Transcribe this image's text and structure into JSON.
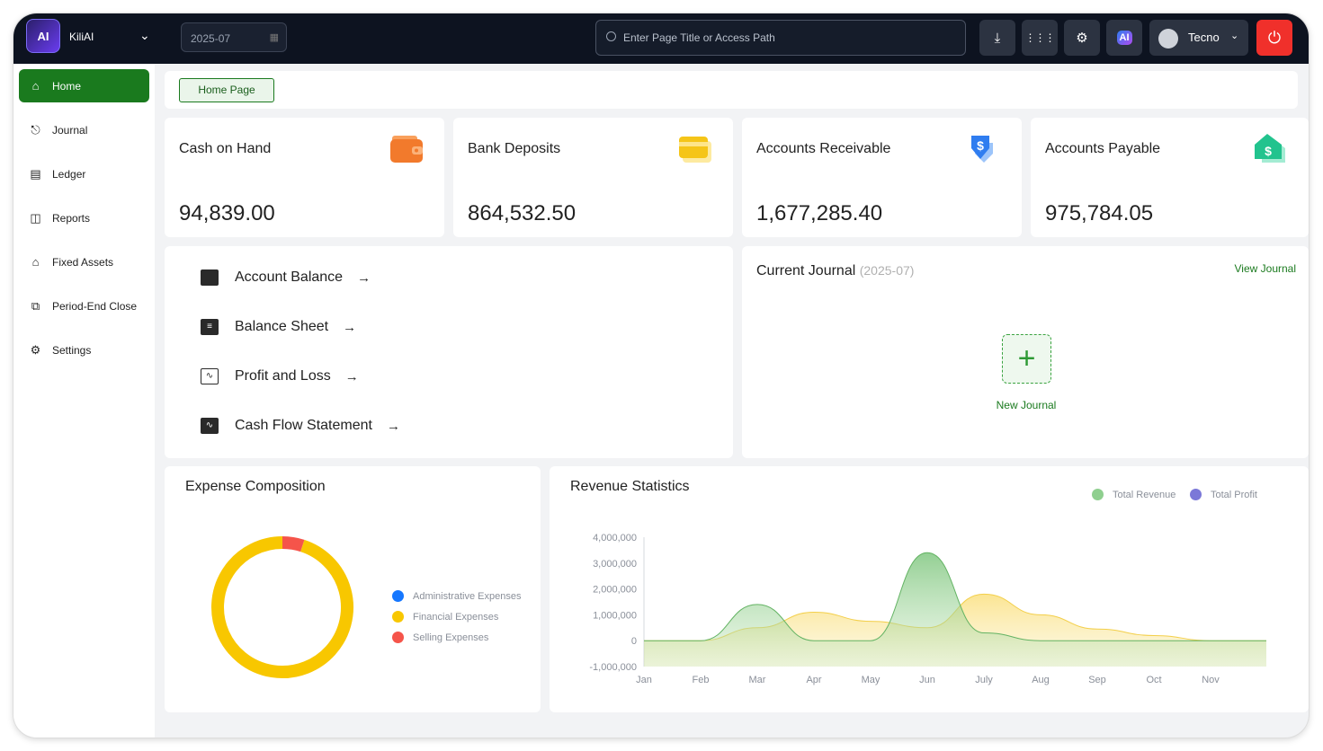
{
  "app": {
    "name": "KiliAI",
    "logo_text": "AI"
  },
  "header": {
    "period": "2025-07",
    "search_placeholder": "Enter Page Title or Access Path",
    "user_name": "Tecno",
    "ai_badge": "AI"
  },
  "sidebar": {
    "items": [
      {
        "label": "Home",
        "icon": "home-icon",
        "active": true
      },
      {
        "label": "Journal",
        "icon": "stamp-icon"
      },
      {
        "label": "Ledger",
        "icon": "ledger-icon"
      },
      {
        "label": "Reports",
        "icon": "reports-icon"
      },
      {
        "label": "Fixed Assets",
        "icon": "bank-icon"
      },
      {
        "label": "Period-End Close",
        "icon": "close-period-icon"
      },
      {
        "label": "Settings",
        "icon": "gear-icon"
      }
    ]
  },
  "breadcrumb": {
    "current": "Home Page"
  },
  "stats": [
    {
      "title": "Cash on Hand",
      "value": "94,839.00",
      "icon": "wallet-icon",
      "color": "#f27a2c"
    },
    {
      "title": "Bank Deposits",
      "value": "864,532.50",
      "icon": "card-icon",
      "color": "#f5c518"
    },
    {
      "title": "Accounts Receivable",
      "value": "1,677,285.40",
      "icon": "receivable-dollar-icon",
      "color": "#2f7df0"
    },
    {
      "title": "Accounts Payable",
      "value": "975,784.05",
      "icon": "payable-dollar-icon",
      "color": "#22c38e"
    }
  ],
  "reports": {
    "links": [
      {
        "label": "Account Balance",
        "icon": "wallet-icon"
      },
      {
        "label": "Balance Sheet",
        "icon": "sheet-icon"
      },
      {
        "label": "Profit and Loss",
        "icon": "line-chart-icon"
      },
      {
        "label": "Cash Flow Statement",
        "icon": "pulse-icon"
      }
    ]
  },
  "journal": {
    "title": "Current Journal",
    "period": "(2025-07)",
    "view_link": "View Journal",
    "new_label": "New Journal"
  },
  "colors": {
    "brand": "#1a7a1e",
    "topbar": "#0d1320",
    "danger": "#f0302b"
  },
  "chart_data": [
    {
      "type": "pie",
      "title": "Expense Composition",
      "donut": true,
      "series": [
        {
          "name": "Administrative Expenses",
          "value": 0,
          "color": "#1677ff"
        },
        {
          "name": "Financial Expenses",
          "value": 95,
          "color": "#f8c700"
        },
        {
          "name": "Selling Expenses",
          "value": 5,
          "color": "#f5544a"
        }
      ],
      "legend_position": "right"
    },
    {
      "type": "area",
      "title": "Revenue Statistics",
      "categories": [
        "Jan",
        "Feb",
        "Mar",
        "Apr",
        "May",
        "Jun",
        "July",
        "Aug",
        "Sep",
        "Oct",
        "Nov"
      ],
      "ylim": [
        -1000000,
        4000000
      ],
      "yticks": [
        "4,000,000",
        "3,000,000",
        "2,000,000",
        "1,000,000",
        "0",
        "-1,000,000"
      ],
      "ytick_values": [
        4000000,
        3000000,
        2000000,
        1000000,
        0,
        -1000000
      ],
      "legend_position": "top-right",
      "series": [
        {
          "name": "Total Revenue",
          "color": "#8fcf8f",
          "values": [
            0,
            0,
            1400000,
            0,
            0,
            3400000,
            300000,
            0,
            0,
            0,
            0
          ]
        },
        {
          "name": "Total Profit",
          "color": "#7b78d8",
          "values": [
            0,
            0,
            500000,
            1100000,
            750000,
            500000,
            1800000,
            1000000,
            450000,
            200000,
            0
          ]
        }
      ]
    }
  ]
}
